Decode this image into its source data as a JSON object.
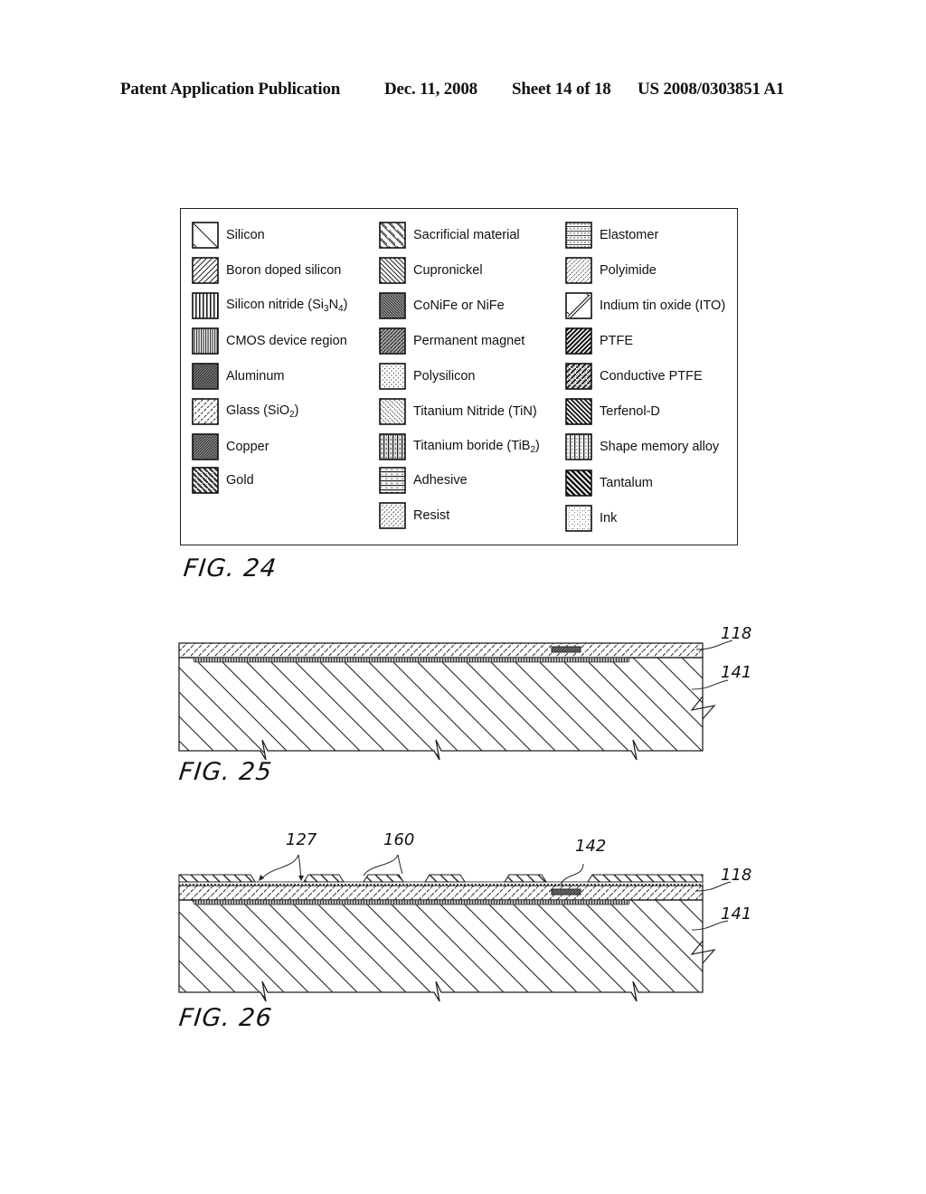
{
  "header": {
    "publication": "Patent Application Publication",
    "date": "Dec. 11, 2008",
    "sheet": "Sheet 14 of 18",
    "number": "US 2008/0303851 A1"
  },
  "legend": {
    "columns": [
      [
        {
          "label": "Silicon",
          "pattern": "silicon"
        },
        {
          "label": "Boron doped silicon",
          "pattern": "boron"
        },
        {
          "label": "Silicon nitride (Si3N4)",
          "pattern": "nitride",
          "sub": [
            "3",
            "4"
          ],
          "parts": [
            "Silicon nitride (Si",
            "N",
            ")"
          ]
        },
        {
          "label": "CMOS device region",
          "pattern": "cmos"
        },
        {
          "label": "Aluminum",
          "pattern": "aluminum"
        },
        {
          "label": "Glass (SiO2)",
          "pattern": "glass",
          "sub": [
            "2"
          ],
          "parts": [
            "Glass (SiO",
            ")"
          ]
        },
        {
          "label": "Copper",
          "pattern": "copper"
        },
        {
          "label": "Gold",
          "pattern": "gold"
        }
      ],
      [
        {
          "label": "Sacrificial material",
          "pattern": "sacrificial"
        },
        {
          "label": "Cupronickel",
          "pattern": "cupronickel"
        },
        {
          "label": "CoNiFe or NiFe",
          "pattern": "conife"
        },
        {
          "label": "Permanent magnet",
          "pattern": "magnet"
        },
        {
          "label": "Polysilicon",
          "pattern": "polysilicon"
        },
        {
          "label": "Titanium Nitride (TiN)",
          "pattern": "tin"
        },
        {
          "label": "Titanium boride (TiB2)",
          "pattern": "tib2",
          "sub": [
            "2"
          ],
          "parts": [
            "Titanium boride (TiB",
            ")"
          ]
        },
        {
          "label": "Adhesive",
          "pattern": "adhesive"
        },
        {
          "label": "Resist",
          "pattern": "resist"
        }
      ],
      [
        {
          "label": "Elastomer",
          "pattern": "elastomer"
        },
        {
          "label": "Polyimide",
          "pattern": "polyimide"
        },
        {
          "label": "Indium tin oxide (ITO)",
          "pattern": "ito"
        },
        {
          "label": "PTFE",
          "pattern": "ptfe"
        },
        {
          "label": "Conductive PTFE",
          "pattern": "cptfe"
        },
        {
          "label": "Terfenol-D",
          "pattern": "terfenol"
        },
        {
          "label": "Shape memory alloy",
          "pattern": "sma"
        },
        {
          "label": "Tantalum",
          "pattern": "tantalum"
        },
        {
          "label": "Ink",
          "pattern": "ink"
        }
      ]
    ]
  },
  "figures": {
    "fig24": {
      "label": "FIG. 24"
    },
    "fig25": {
      "label": "FIG. 25",
      "refs": {
        "layer_glass": "118",
        "substrate": "141"
      }
    },
    "fig26": {
      "label": "FIG. 26",
      "refs": {
        "ink_holes": "127",
        "electrodes": "160",
        "contact": "142",
        "layer_glass": "118",
        "substrate": "141"
      }
    }
  }
}
